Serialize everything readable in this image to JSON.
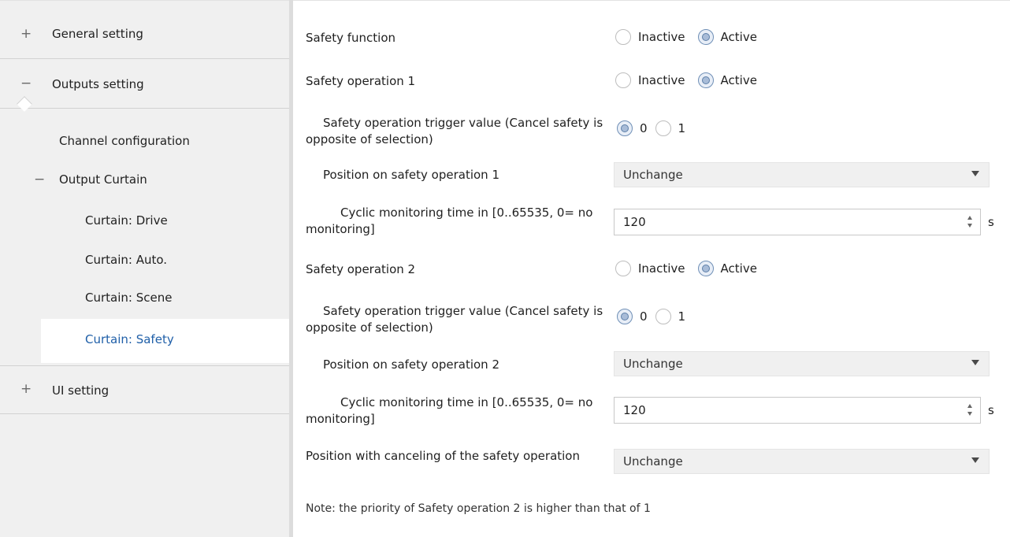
{
  "sidebar": {
    "groups": [
      {
        "sign": "+",
        "label": "General setting"
      },
      {
        "sign": "−",
        "label": "Outputs setting"
      },
      {
        "sign": "+",
        "label": "UI setting"
      }
    ],
    "channel_configuration": "Channel configuration",
    "output_curtain": {
      "sign": "−",
      "label": "Output Curtain"
    },
    "curtain_items": [
      "Curtain: Drive",
      "Curtain: Auto.",
      "Curtain: Scene",
      "Curtain: Safety"
    ],
    "selected_item": "Curtain: Safety",
    "selected_color": "#1f5fa8"
  },
  "main": {
    "safety_function": {
      "label": "Safety function",
      "options": [
        "Inactive",
        "Active"
      ],
      "selected": "Active"
    },
    "safety_op1": {
      "label": "Safety operation 1",
      "options": [
        "Inactive",
        "Active"
      ],
      "selected": "Active"
    },
    "trigger1": {
      "label": "Safety operation trigger value (Cancel safety is opposite of  selection)",
      "options": [
        "0",
        "1"
      ],
      "selected": "0"
    },
    "position1": {
      "label": "Position on safety operation 1",
      "value": "Unchange"
    },
    "cyclic1": {
      "label": "Cyclic monitoring time in [0..65535, 0= no monitoring]",
      "value": "120",
      "unit": "s"
    },
    "safety_op2": {
      "label": "Safety operation 2",
      "options": [
        "Inactive",
        "Active"
      ],
      "selected": "Active"
    },
    "trigger2": {
      "label": "Safety operation trigger value (Cancel safety is opposite of  selection)",
      "options": [
        "0",
        "1"
      ],
      "selected": "0"
    },
    "position2": {
      "label": "Position on safety operation 2",
      "value": "Unchange"
    },
    "cyclic2": {
      "label": "Cyclic monitoring time in [0..65535, 0= no monitoring]",
      "value": "120",
      "unit": "s"
    },
    "cancel_position": {
      "label": "Position with canceling of the safety operation",
      "value": "Unchange"
    },
    "note": "Note: the priority of Safety operation 2 is higher than that of 1"
  },
  "icons": {
    "expand": "plus-icon",
    "collapse": "minus-icon",
    "dropdown": "chevron-down-icon",
    "spinner": "spin-arrows-icon"
  }
}
